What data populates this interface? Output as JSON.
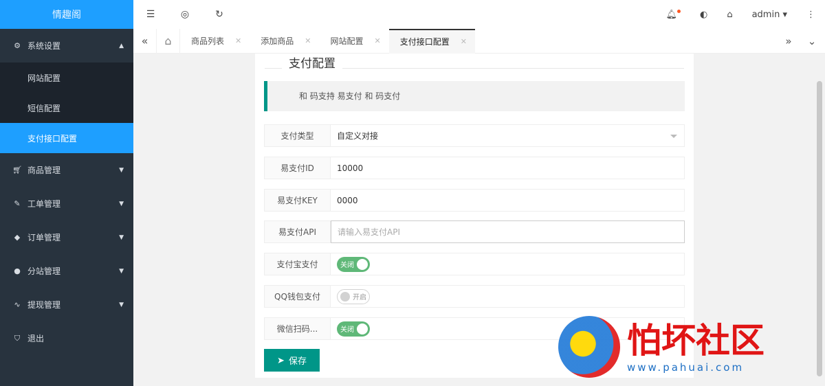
{
  "brand": "情趣阁",
  "sidebar": {
    "items": [
      {
        "label": "系统设置",
        "icon": "gear-icon",
        "expanded": true,
        "children": [
          {
            "label": "网站配置"
          },
          {
            "label": "短信配置"
          },
          {
            "label": "支付接口配置",
            "active": true
          }
        ]
      },
      {
        "label": "商品管理",
        "icon": "cart-icon"
      },
      {
        "label": "工单管理",
        "icon": "ticket-icon"
      },
      {
        "label": "订单管理",
        "icon": "layers-icon"
      },
      {
        "label": "分站管理",
        "icon": "globe-icon"
      },
      {
        "label": "提现管理",
        "icon": "pulse-icon"
      },
      {
        "label": "退出",
        "icon": "shield-icon"
      }
    ]
  },
  "header": {
    "user": "admin"
  },
  "tabs": [
    {
      "label": "商品列表"
    },
    {
      "label": "添加商品"
    },
    {
      "label": "网站配置"
    },
    {
      "label": "支付接口配置",
      "active": true
    }
  ],
  "form": {
    "title": "支付配置",
    "notice": "和 码支持 易支付 和 码支付",
    "fields": [
      {
        "label": "支付类型",
        "value": "自定义对接"
      },
      {
        "label": "易支付ID",
        "value": "10000"
      },
      {
        "label": "易支付KEY",
        "value": "0000"
      },
      {
        "label": "易支付API",
        "placeholder": "请输入易支付API"
      }
    ],
    "switches": [
      {
        "label": "支付宝支付",
        "text": "关闭",
        "on": true
      },
      {
        "label": "QQ钱包支付",
        "text": "开启",
        "on": false
      },
      {
        "label": "微信扫码...",
        "text": "关闭",
        "on": true
      }
    ],
    "save": "保存"
  },
  "watermark": {
    "title": "怕坏社区",
    "url": "www.pahuai.com"
  },
  "colors": {
    "brand": "#1e9fff",
    "sidebar": "#28333e",
    "primary": "#009688",
    "switch_on": "#5fb878"
  }
}
